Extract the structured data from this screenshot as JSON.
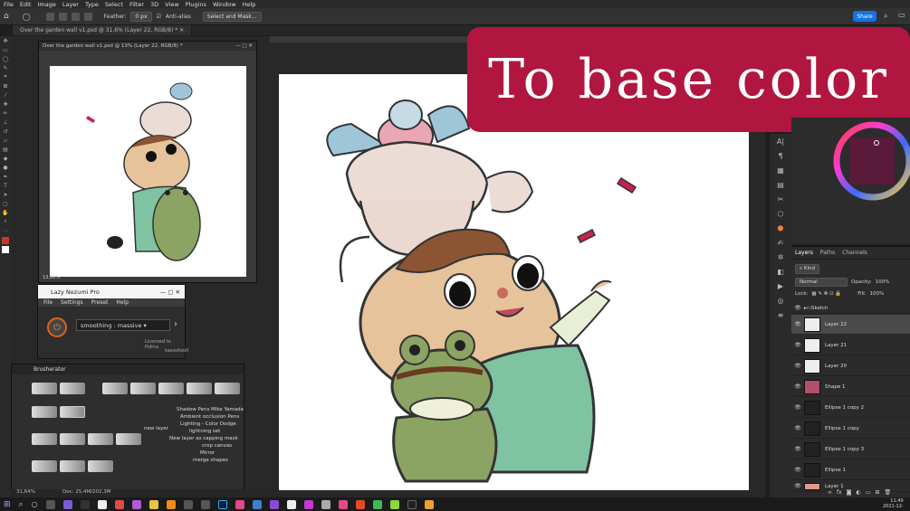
{
  "menu": [
    "File",
    "Edit",
    "Image",
    "Layer",
    "Type",
    "Select",
    "Filter",
    "3D",
    "View",
    "Plugins",
    "Window",
    "Help"
  ],
  "options": {
    "feather_label": "Feather:",
    "feather_value": "0 px",
    "antialias_label": "Anti-alias",
    "select_mask": "Select and Mask..."
  },
  "share_label": "Share",
  "doc_tab": "Over the garden wall v1.psd @ 31,6% (Layer 22, RGB/8) *",
  "float_title": "Over the garden wall v1.psd @ 13% (Layer 22, RGB/8) *",
  "float_zoom": "13,01%",
  "lazy": {
    "title": "Lazy Nezumi Pro",
    "menu": [
      "File",
      "Settings",
      "Preset",
      "Help"
    ],
    "preset": "smoothing : massive",
    "license": "Licensed to Polina",
    "extra": "kasssitoolt"
  },
  "brusherator": {
    "title": "Brusherator",
    "labels": [
      "Shadow Pens Mike Yamada",
      "Ambient occlusion Pens",
      "Lighting - Color Dodge",
      "lightning set",
      "New layer as capping mask",
      "crop canvas",
      "Mirror",
      "merge shapes",
      "new layer"
    ]
  },
  "banner_text": "To base color",
  "layers": {
    "tabs": [
      "Layers",
      "Paths",
      "Channels"
    ],
    "kind": "Kind",
    "blend": "Normal",
    "opacity_label": "Opacity:",
    "opacity": "100%",
    "lock_label": "Lock:",
    "fill_label": "Fill:",
    "fill": "100%",
    "items": [
      "Sketch",
      "Layer 22",
      "Layer 21",
      "Layer 20",
      "Shape 1",
      "Ellipse 1 copy 2",
      "Ellipse 1 copy",
      "Ellipse 1 copy 3",
      "Ellipse 1",
      "Layer 1"
    ]
  },
  "status": {
    "zoom": "31,64%",
    "doc": "Doc: 25,4M/202,3M"
  },
  "clock": {
    "time": "11:49",
    "date": "2021-12-"
  }
}
